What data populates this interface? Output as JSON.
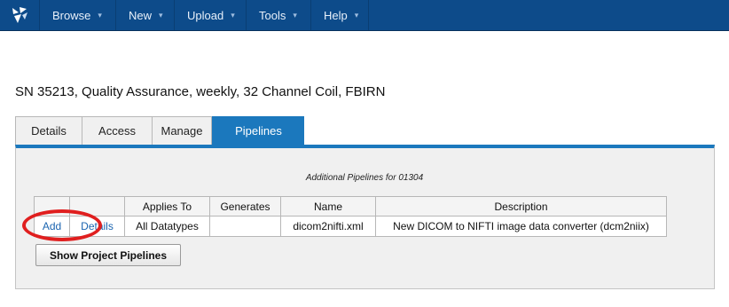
{
  "navbar": {
    "items": [
      {
        "label": "Browse",
        "caret": "▾"
      },
      {
        "label": "New",
        "caret": "▾"
      },
      {
        "label": "Upload",
        "caret": "▾"
      },
      {
        "label": "Tools",
        "caret": "▾"
      },
      {
        "label": "Help",
        "caret": "▾"
      }
    ],
    "logo_icon": "xnat-bird-logo-icon",
    "background": "#0d4b8a"
  },
  "page_title": "SN 35213, Quality Assurance, weekly, 32 Channel Coil, FBIRN",
  "tabs": [
    {
      "label": "Details",
      "active": false
    },
    {
      "label": "Access",
      "active": false
    },
    {
      "label": "Manage",
      "active": false
    },
    {
      "label": "Pipelines",
      "active": true
    }
  ],
  "accent_color": "#1b78bd",
  "pipelines_section": {
    "caption": "Additional Pipelines for 01304",
    "columns": [
      "",
      "",
      "Applies To",
      "Generates",
      "Name",
      "Description"
    ],
    "rows": [
      {
        "add": "Add",
        "details": "Details",
        "applies_to": "All Datatypes",
        "generates": "",
        "name": "dicom2nifti.xml",
        "description": "New DICOM to NIFTI image data converter (dcm2niix)"
      }
    ],
    "show_button": "Show Project Pipelines"
  },
  "annotation_color": "#e01f1f"
}
